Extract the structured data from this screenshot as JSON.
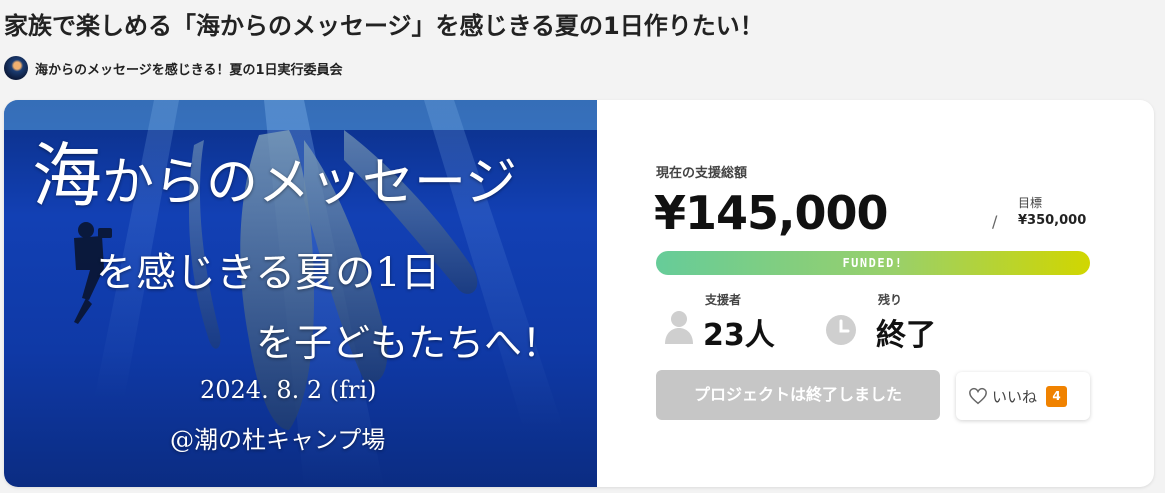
{
  "project": {
    "title": "家族で楽しめる「海からのメッセージ」を感じきる夏の1日作りたい！",
    "owner_name": "海からのメッセージを感じきる！夏の1日実行委員会"
  },
  "hero_image": {
    "line1_big": "海",
    "line1_rest": "からのメッセージ",
    "line2": "を感じきる夏の1日",
    "line3": "を子どもたちへ！",
    "date": "2024. 8. 2 (fri)",
    "venue": "@潮の杜キャンプ場"
  },
  "funding": {
    "total_label": "現在の支援総額",
    "total_amount": "¥145,000",
    "separator": "/",
    "goal_label": "目標",
    "goal_amount": "¥350,000",
    "status_badge": "FUNDED!",
    "supporters_label": "支援者",
    "supporters_value": "23人",
    "remaining_label": "残り",
    "remaining_value": "終了"
  },
  "actions": {
    "ended_button_label": "プロジェクトは終了しました",
    "like_label": "いいね",
    "like_count": "4"
  },
  "colors": {
    "accent_orange": "#f08200",
    "progress_start": "#66cc99",
    "progress_end": "#d1d600",
    "disabled_button": "#c6c6c6"
  },
  "icons": [
    "supporter-person-icon",
    "clock-icon",
    "heart-outline-icon"
  ]
}
